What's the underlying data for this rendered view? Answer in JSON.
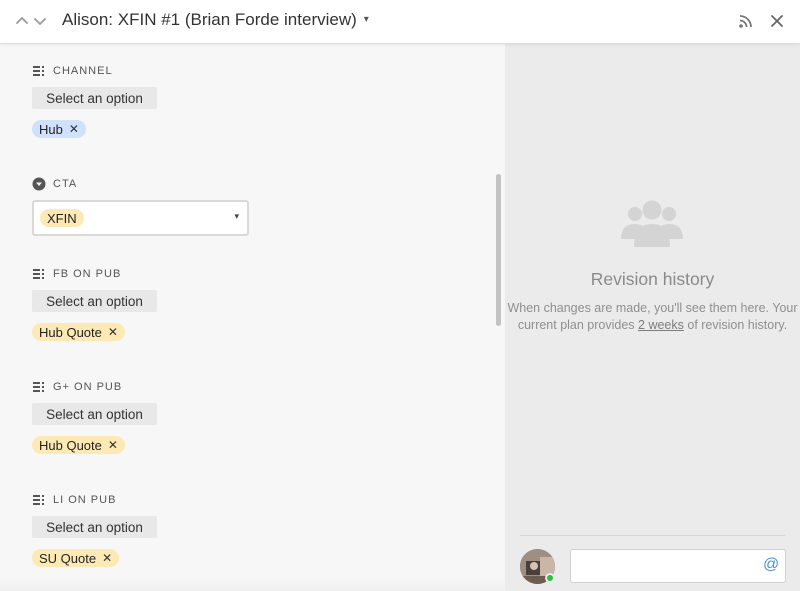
{
  "header": {
    "title": "Alison: XFIN #1 (Brian Forde interview)",
    "title_caret": "▾",
    "icons": [
      "chevron-up-icon",
      "chevron-down-icon",
      "rss-feed-icon",
      "close-icon"
    ]
  },
  "fields": {
    "channel": {
      "label": "CHANNEL",
      "select_label": "Select an option",
      "chip": "Hub"
    },
    "cta": {
      "label": "CTA",
      "value": "XFIN",
      "caret": "▾"
    },
    "fb_on_pub": {
      "label": "FB ON PUB",
      "select_label": "Select an option",
      "chip": "Hub Quote"
    },
    "gplus_on_pub": {
      "label": "G+ ON PUB",
      "select_label": "Select an option",
      "chip": "Hub Quote"
    },
    "li_on_pub": {
      "label": "LI ON PUB",
      "select_label": "Select an option",
      "chip": "SU Quote"
    }
  },
  "chip_remove": "✕",
  "revision": {
    "title": "Revision history",
    "text_before": "When changes are made, you'll see them here. Your current plan provides ",
    "link": "2 weeks",
    "text_after": " of revision history."
  },
  "comment": {
    "input_value": "",
    "input_placeholder": "",
    "mention_symbol": "@",
    "online_status": "online"
  },
  "colors": {
    "chip_blue": "#d0e1fb",
    "chip_yellow": "#fde9b3",
    "presence_green": "#2fbf3c",
    "mention_blue": "#4a90d9"
  }
}
